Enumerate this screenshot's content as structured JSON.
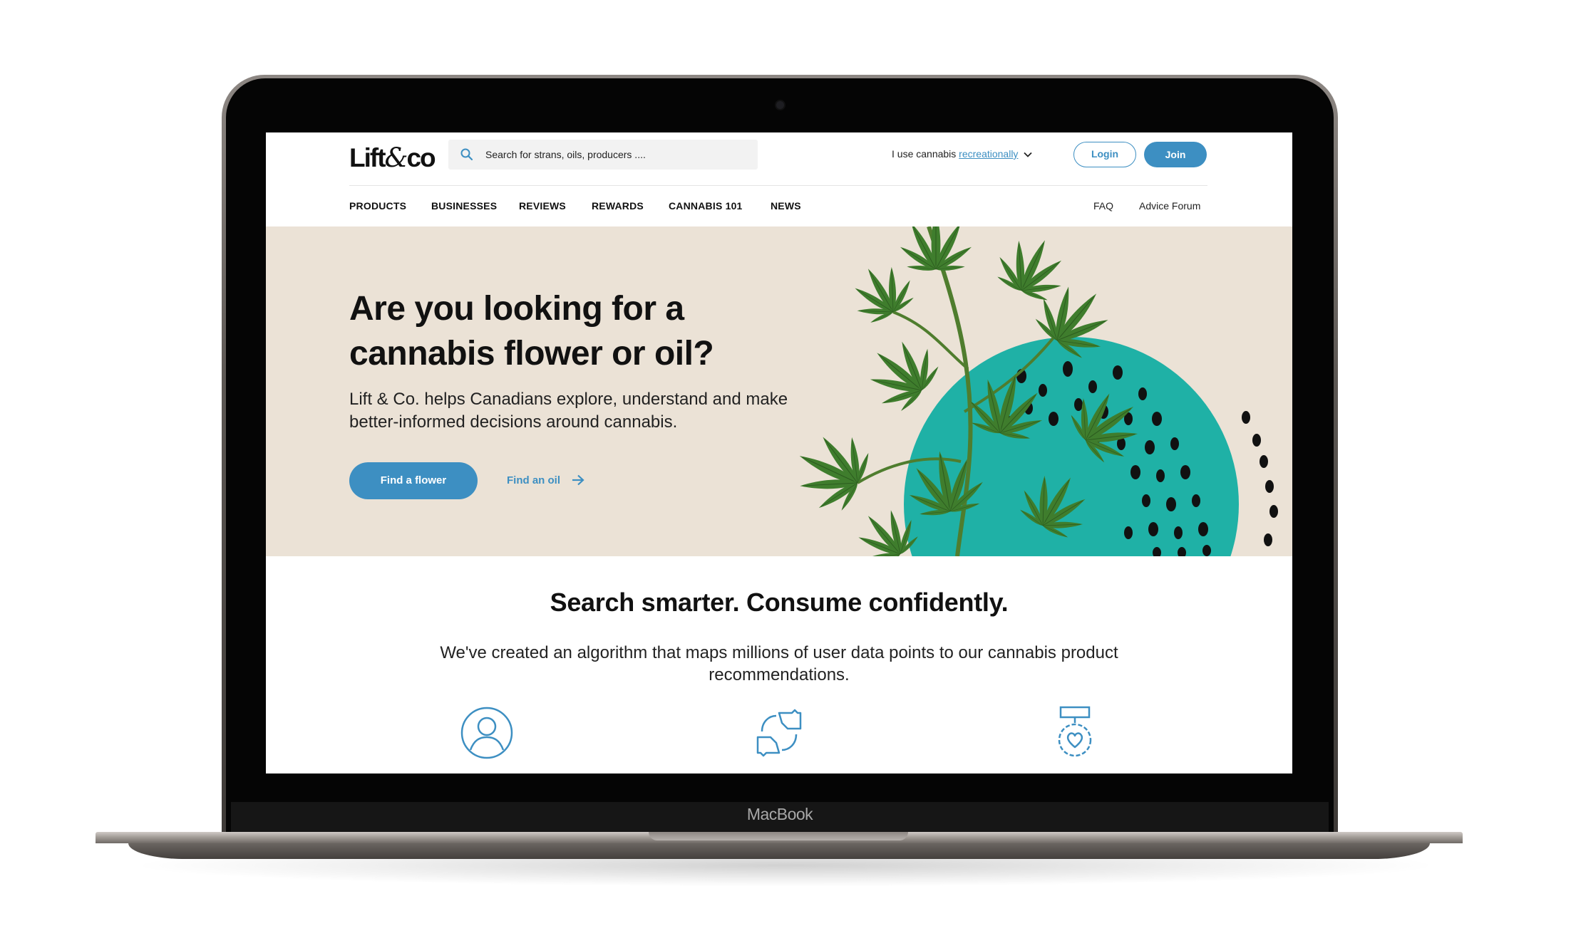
{
  "device": {
    "label": "MacBook"
  },
  "header": {
    "logo": {
      "text_left": "Lift",
      "amp": "&",
      "text_right": "co"
    },
    "search": {
      "placeholder": "Search for strans, oils, producers ...."
    },
    "usage": {
      "prefix": "I use cannabis ",
      "value": "recreationally"
    },
    "login_label": "Login",
    "join_label": "Join"
  },
  "nav": {
    "items": [
      {
        "label": "PRODUCTS"
      },
      {
        "label": "BUSINESSES"
      },
      {
        "label": "REVIEWS"
      },
      {
        "label": "REWARDS"
      },
      {
        "label": "CANNABIS 101"
      },
      {
        "label": "NEWS"
      }
    ],
    "right_items": [
      {
        "label": "FAQ"
      },
      {
        "label": "Advice Forum"
      }
    ]
  },
  "hero": {
    "title": "Are you looking for a cannabis flower or oil?",
    "subtitle": "Lift & Co. helps Canadians explore, understand and make better-informed decisions around cannabis.",
    "primary_button": "Find a flower",
    "secondary_link": "Find an oil"
  },
  "section2": {
    "title": "Search smarter. Consume confidently.",
    "subtitle": "We've created an algorithm that maps millions of user data points to our cannabis product recommendations.",
    "icons": [
      "user-profile-icon",
      "thumbs-up-down-icon",
      "heart-badge-icon"
    ]
  },
  "colors": {
    "accent": "#3d8fc2",
    "hero_bg": "#ebe2d6",
    "teal": "#1fb1a6",
    "leaf": "#3f7d2d"
  }
}
